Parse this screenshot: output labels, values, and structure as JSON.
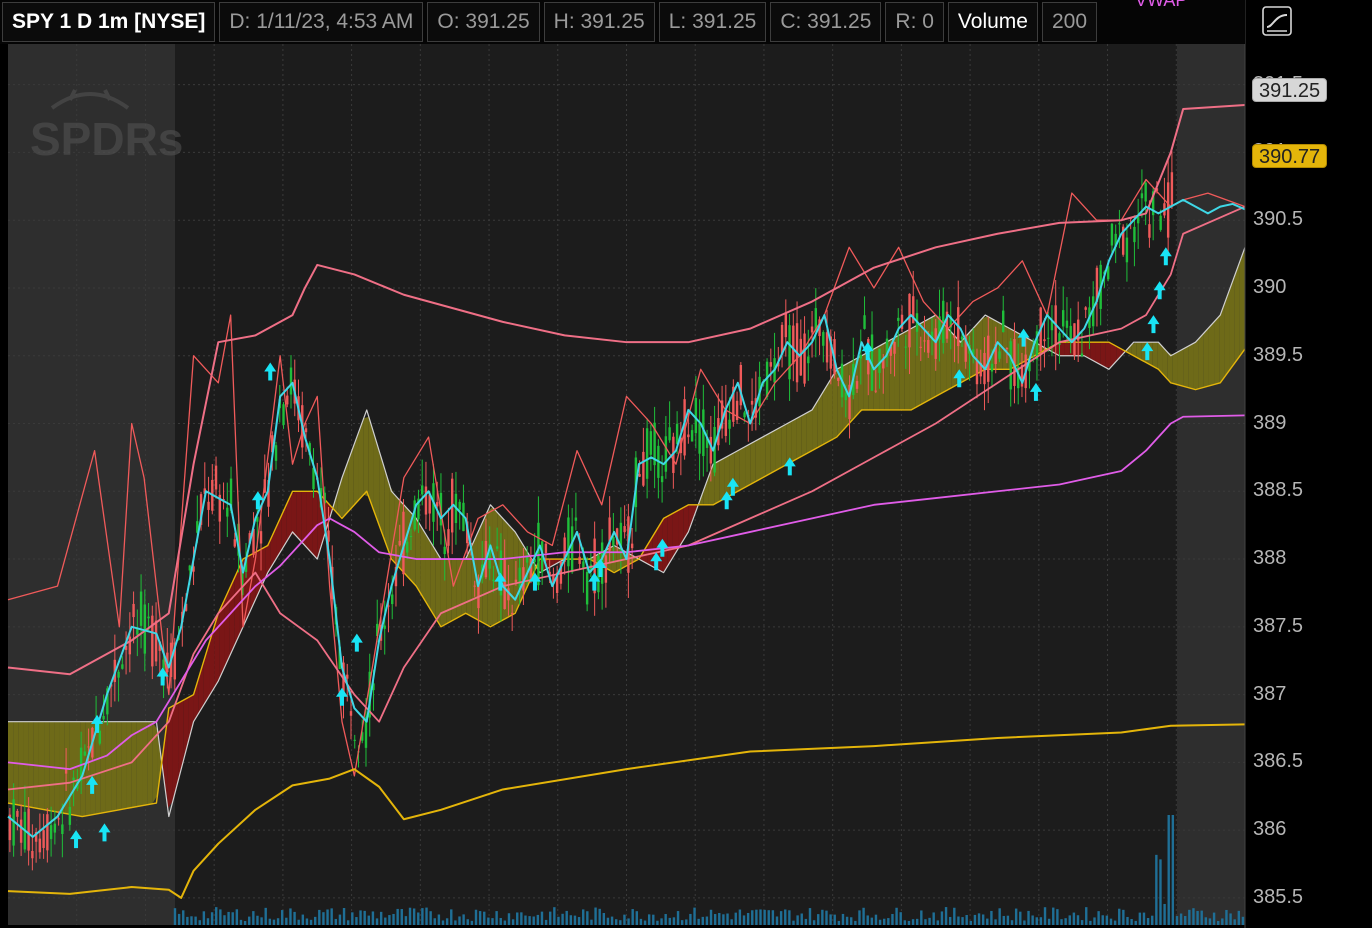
{
  "header": {
    "symbol": "SPY 1 D 1m [NYSE]",
    "date": "D: 1/11/23, 4:53 AM",
    "open": "O: 391.25",
    "high": "H: 391.25",
    "low": "L: 391.25",
    "close": "C: 391.25",
    "range": "R: 0",
    "volume_label": "Volume",
    "volume_value": "200",
    "vwap_label": "VWAP"
  },
  "price_tags": {
    "last": "391.25",
    "vwap": "390.77"
  },
  "watermark": "SPDRs",
  "colors": {
    "background": "#000000",
    "session_shade": "#2e2e2e",
    "up_candle": "#1fbf3a",
    "down_candle": "#f05a5a",
    "vwap": "#e4b50a",
    "bollinger": "#ef6f86",
    "ema": "#3fd7e6",
    "ma_slow": "#e05ce8",
    "cloud_bull": "#6e6a18",
    "cloud_bear": "#7a1616",
    "arrow": "#19e4f5",
    "volume": "#1f6f96"
  },
  "icons": {
    "settings": "chart-style-icon",
    "arrow": "up-arrow-icon"
  },
  "chart_data": {
    "type": "line",
    "title": "SPY 1 D 1m [NYSE]",
    "ylim": [
      385.3,
      391.8
    ],
    "yticks": [
      "391.5",
      "391",
      "390.5",
      "390",
      "389.5",
      "389",
      "388.5",
      "388",
      "387.5",
      "387",
      "386.5",
      "386",
      "385.5"
    ],
    "ytick_values": [
      391.5,
      391.0,
      390.5,
      390.0,
      389.5,
      389.0,
      388.5,
      388.0,
      387.5,
      387.0,
      386.5,
      386.0,
      385.5
    ],
    "x_domain": [
      0,
      100
    ],
    "session_shading": [
      [
        0,
        13.5
      ],
      [
        94.5,
        100
      ]
    ],
    "series": [
      {
        "name": "VWAP",
        "role": "vwap",
        "x": [
          0,
          5,
          10,
          13,
          14,
          15,
          17,
          20,
          23,
          26,
          28,
          30,
          32,
          35,
          40,
          50,
          60,
          70,
          80,
          90,
          94,
          100
        ],
        "values": [
          385.55,
          385.53,
          385.58,
          385.56,
          385.5,
          385.7,
          385.9,
          386.15,
          386.33,
          386.38,
          386.45,
          386.32,
          386.08,
          386.15,
          386.3,
          386.45,
          386.58,
          386.62,
          386.68,
          386.72,
          386.77,
          386.78
        ]
      },
      {
        "name": "Bollinger Upper",
        "role": "bb_upper",
        "x": [
          0,
          5,
          10,
          13,
          15,
          17,
          20,
          23,
          24,
          25,
          28,
          32,
          40,
          45,
          50,
          55,
          60,
          65,
          70,
          75,
          80,
          85,
          90,
          92,
          94,
          95,
          100
        ],
        "values": [
          387.2,
          387.15,
          387.4,
          387.6,
          388.7,
          389.6,
          389.65,
          389.8,
          390.0,
          390.17,
          390.1,
          389.95,
          389.75,
          389.65,
          389.6,
          389.6,
          389.7,
          389.9,
          390.15,
          390.3,
          390.4,
          390.48,
          390.5,
          390.55,
          391.0,
          391.32,
          391.35
        ]
      },
      {
        "name": "Bollinger Lower",
        "role": "bb_lower",
        "x": [
          0,
          5,
          10,
          13,
          15,
          17,
          20,
          22,
          25,
          28,
          30,
          32,
          35,
          40,
          50,
          55,
          60,
          65,
          70,
          75,
          80,
          85,
          90,
          92,
          94,
          95,
          100
        ],
        "values": [
          386.3,
          386.35,
          386.5,
          386.8,
          387.3,
          387.6,
          387.9,
          387.6,
          387.4,
          387.0,
          386.8,
          387.2,
          387.6,
          387.8,
          388.0,
          388.1,
          388.3,
          388.5,
          388.75,
          389.0,
          389.3,
          389.6,
          389.7,
          389.8,
          390.1,
          390.4,
          390.6
        ]
      },
      {
        "name": "EMA",
        "role": "ema",
        "x": [
          0,
          2,
          4,
          6,
          8,
          10,
          12,
          13,
          14,
          15,
          16,
          18,
          19,
          20,
          21,
          22,
          23,
          24,
          25,
          26,
          27,
          28,
          29,
          30,
          31,
          32,
          33,
          34,
          35,
          36,
          37,
          38,
          39,
          40,
          41,
          42,
          43,
          44,
          45,
          46,
          47,
          48,
          49,
          50,
          51,
          52,
          53,
          54,
          55,
          56,
          57,
          58,
          59,
          60,
          61,
          62,
          63,
          64,
          65,
          66,
          67,
          68,
          69,
          70,
          71,
          72,
          73,
          74,
          75,
          76,
          77,
          78,
          79,
          80,
          81,
          82,
          83,
          84,
          85,
          86,
          87,
          88,
          89,
          90,
          91,
          92,
          93,
          94,
          95,
          96,
          97,
          98,
          99,
          100
        ],
        "values": [
          386.1,
          385.95,
          386.1,
          386.4,
          387.0,
          387.5,
          387.45,
          387.2,
          387.5,
          388.0,
          388.5,
          388.4,
          387.9,
          388.3,
          388.5,
          389.2,
          389.3,
          388.9,
          388.6,
          388.0,
          387.2,
          386.9,
          386.8,
          387.4,
          387.8,
          388.1,
          388.4,
          388.5,
          388.3,
          388.4,
          388.3,
          387.8,
          388.1,
          387.8,
          387.7,
          387.9,
          388.1,
          387.8,
          388.0,
          388.2,
          387.9,
          388.0,
          388.2,
          388.0,
          388.7,
          388.75,
          388.7,
          388.8,
          389.1,
          389.0,
          388.8,
          389.1,
          389.3,
          389.0,
          389.3,
          389.4,
          389.6,
          389.5,
          389.6,
          389.8,
          389.4,
          389.2,
          389.6,
          389.4,
          389.5,
          389.7,
          389.8,
          389.7,
          389.6,
          389.8,
          389.7,
          389.5,
          389.4,
          389.6,
          389.5,
          389.3,
          389.6,
          389.8,
          389.7,
          389.6,
          389.7,
          389.9,
          390.2,
          390.4,
          390.5,
          390.6,
          390.55,
          390.6,
          390.65,
          390.6,
          390.55,
          390.6,
          390.62,
          390.58
        ]
      },
      {
        "name": "Slow MA",
        "role": "ma_slow",
        "x": [
          0,
          5,
          8,
          10,
          12,
          14,
          16,
          18,
          20,
          22,
          24,
          25,
          26,
          27,
          28,
          30,
          33,
          36,
          40,
          45,
          50,
          55,
          60,
          65,
          70,
          75,
          80,
          85,
          90,
          92,
          94,
          95,
          100
        ],
        "values": [
          386.5,
          386.45,
          386.55,
          386.7,
          386.8,
          387.1,
          387.4,
          387.6,
          387.8,
          387.95,
          388.15,
          388.25,
          388.3,
          388.25,
          388.2,
          388.05,
          388.0,
          388.0,
          388.0,
          388.05,
          388.05,
          388.1,
          388.2,
          388.3,
          388.4,
          388.45,
          388.5,
          388.55,
          388.65,
          388.8,
          389.0,
          389.05,
          389.06
        ]
      },
      {
        "name": "Cloud Upper",
        "role": "cloud_a",
        "x": [
          0,
          3,
          6,
          9,
          12,
          13,
          15,
          17,
          19,
          21,
          23,
          25,
          27,
          29,
          31,
          33,
          35,
          37,
          39,
          41,
          43,
          45,
          47,
          49,
          51,
          53,
          55,
          57,
          59,
          61,
          63,
          65,
          67,
          69,
          71,
          73,
          75,
          77,
          79,
          81,
          83,
          85,
          87,
          89,
          91,
          93,
          94,
          96,
          98,
          100
        ],
        "values": [
          386.8,
          386.8,
          386.8,
          386.8,
          386.8,
          386.1,
          386.8,
          387.1,
          387.5,
          387.9,
          388.2,
          388.0,
          388.6,
          389.1,
          388.5,
          388.3,
          388.0,
          388.0,
          388.4,
          388.2,
          387.9,
          388.0,
          388.0,
          388.1,
          388.0,
          387.9,
          388.2,
          388.7,
          388.8,
          388.9,
          389.0,
          389.1,
          389.4,
          389.5,
          389.6,
          389.7,
          389.8,
          389.6,
          389.8,
          389.7,
          389.6,
          389.5,
          389.5,
          389.4,
          389.6,
          389.6,
          389.5,
          389.6,
          389.8,
          390.3
        ]
      },
      {
        "name": "Cloud Lower",
        "role": "cloud_b",
        "x": [
          0,
          3,
          6,
          9,
          12,
          13,
          15,
          17,
          19,
          21,
          23,
          25,
          27,
          29,
          31,
          33,
          35,
          37,
          39,
          41,
          43,
          45,
          47,
          49,
          51,
          53,
          55,
          57,
          59,
          61,
          63,
          65,
          67,
          69,
          71,
          73,
          75,
          77,
          79,
          81,
          83,
          85,
          87,
          89,
          91,
          93,
          94,
          96,
          98,
          100
        ],
        "values": [
          386.2,
          386.15,
          386.1,
          386.15,
          386.2,
          386.9,
          387.0,
          387.6,
          388.0,
          388.1,
          388.5,
          388.5,
          388.3,
          388.5,
          388.0,
          387.8,
          387.5,
          387.6,
          387.5,
          387.6,
          388.0,
          388.0,
          388.0,
          387.9,
          388.0,
          388.3,
          388.4,
          388.4,
          388.5,
          388.6,
          388.7,
          388.8,
          388.9,
          389.1,
          389.1,
          389.1,
          389.2,
          389.3,
          389.4,
          389.4,
          389.5,
          389.6,
          389.6,
          389.6,
          389.5,
          389.4,
          389.3,
          389.25,
          389.3,
          389.55
        ]
      },
      {
        "name": "Bollinger Upper Band (tight)",
        "role": "bb_tight",
        "x": [
          0,
          4,
          7,
          9,
          10,
          11,
          12,
          13,
          15,
          17,
          18,
          19,
          20,
          22,
          23,
          24,
          25,
          26,
          27,
          28,
          30,
          32,
          34,
          36,
          38,
          40,
          42,
          44,
          46,
          48,
          50,
          52,
          54,
          56,
          58,
          60,
          62,
          64,
          66,
          68,
          70,
          72,
          74,
          76,
          78,
          80,
          82,
          84,
          86,
          88,
          90,
          92,
          94,
          95,
          97,
          100
        ],
        "values": [
          387.7,
          387.8,
          388.8,
          387.5,
          389.0,
          388.6,
          387.8,
          387.0,
          389.5,
          389.3,
          389.8,
          387.5,
          388.0,
          389.5,
          388.7,
          389.0,
          389.2,
          387.8,
          386.8,
          386.4,
          387.5,
          388.6,
          388.9,
          387.8,
          388.3,
          388.4,
          388.2,
          388.1,
          388.8,
          388.4,
          389.2,
          389.0,
          388.7,
          389.4,
          389.1,
          389.0,
          389.3,
          389.5,
          389.8,
          390.3,
          390.0,
          390.3,
          389.9,
          389.7,
          389.9,
          390.0,
          390.2,
          389.8,
          390.7,
          390.5,
          390.5,
          390.8,
          390.6,
          390.65,
          390.7,
          390.6
        ]
      }
    ],
    "up_arrows_x": [
      5.5,
      6.8,
      7.2,
      7.8,
      12.5,
      20.2,
      21.2,
      27.0,
      28.2,
      39.8,
      42.6,
      47.4,
      47.9,
      52.4,
      52.9,
      58.1,
      58.6,
      63.2,
      69.5,
      76.9,
      82.1,
      83.1,
      92.1,
      92.6,
      93.1,
      93.6
    ],
    "up_arrows_y": [
      386.0,
      386.4,
      386.85,
      386.05,
      387.2,
      388.5,
      389.45,
      387.05,
      387.45,
      387.9,
      387.9,
      387.9,
      388.0,
      388.05,
      388.15,
      388.5,
      388.6,
      388.75,
      389.6,
      389.4,
      389.7,
      389.3,
      389.6,
      389.8,
      390.05,
      390.3
    ]
  }
}
